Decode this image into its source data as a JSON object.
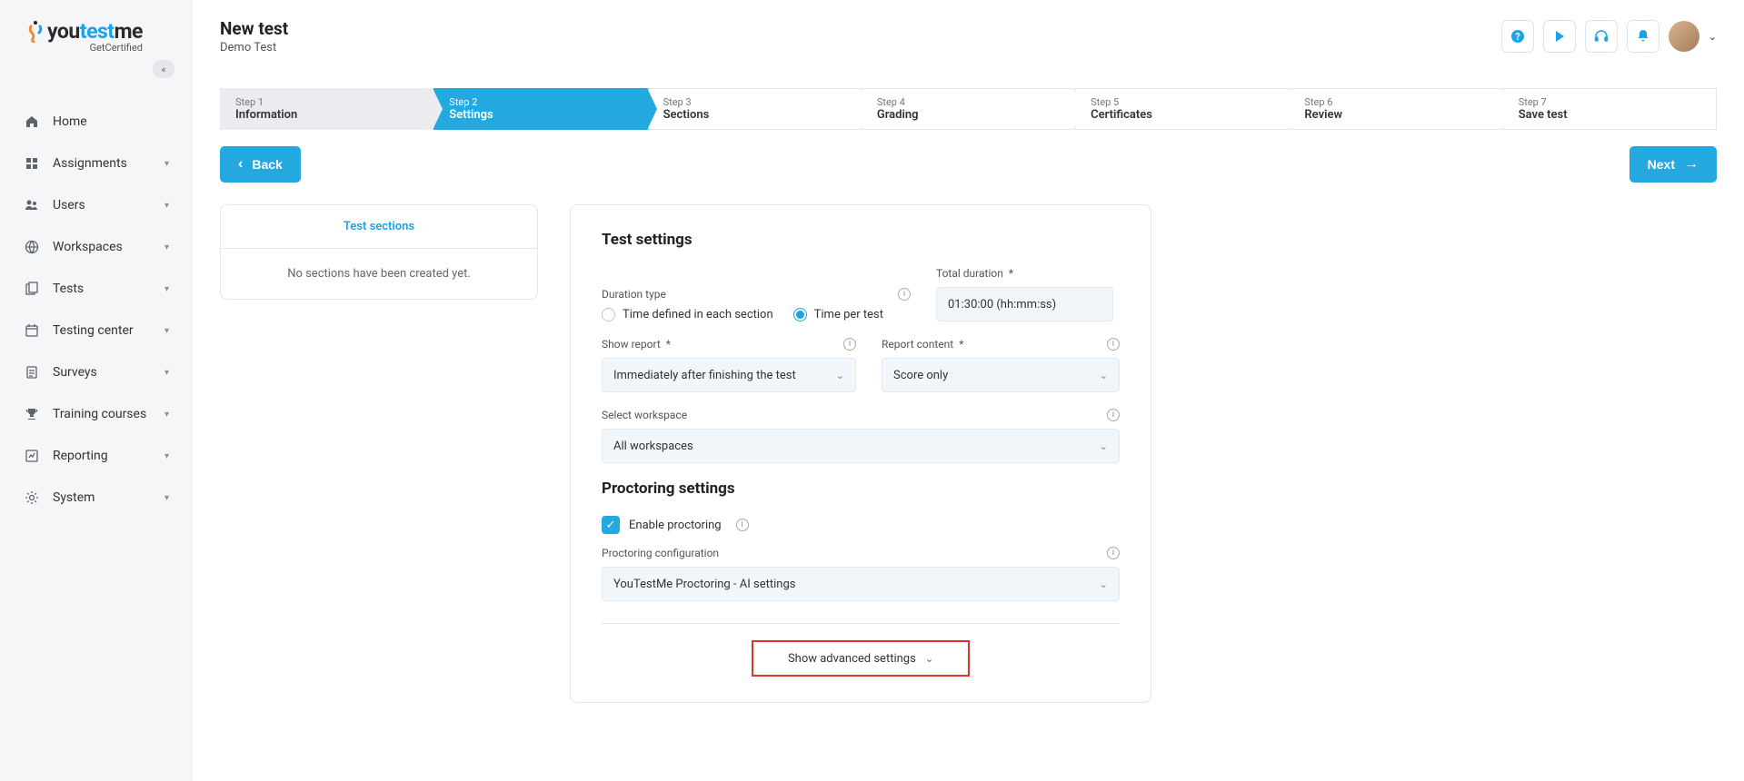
{
  "brand": {
    "you": "you",
    "test": "test",
    "me": "me",
    "sub": "GetCertified"
  },
  "sidebar": {
    "items": [
      {
        "label": "Home",
        "icon": "home",
        "expandable": false
      },
      {
        "label": "Assignments",
        "icon": "assignments",
        "expandable": true
      },
      {
        "label": "Users",
        "icon": "users",
        "expandable": true
      },
      {
        "label": "Workspaces",
        "icon": "globe",
        "expandable": true
      },
      {
        "label": "Tests",
        "icon": "tests",
        "expandable": true
      },
      {
        "label": "Testing center",
        "icon": "calendar",
        "expandable": true
      },
      {
        "label": "Surveys",
        "icon": "surveys",
        "expandable": true
      },
      {
        "label": "Training courses",
        "icon": "trophy",
        "expandable": true
      },
      {
        "label": "Reporting",
        "icon": "reporting",
        "expandable": true
      },
      {
        "label": "System",
        "icon": "gear",
        "expandable": true
      }
    ]
  },
  "page": {
    "title": "New test",
    "subtitle": "Demo Test"
  },
  "stepper": [
    {
      "num": "Step 1",
      "label": "Information",
      "state": "done"
    },
    {
      "num": "Step 2",
      "label": "Settings",
      "state": "active"
    },
    {
      "num": "Step 3",
      "label": "Sections",
      "state": ""
    },
    {
      "num": "Step 4",
      "label": "Grading",
      "state": ""
    },
    {
      "num": "Step 5",
      "label": "Certificates",
      "state": ""
    },
    {
      "num": "Step 6",
      "label": "Review",
      "state": ""
    },
    {
      "num": "Step 7",
      "label": "Save test",
      "state": ""
    }
  ],
  "buttons": {
    "back": "Back",
    "next": "Next"
  },
  "sections_panel": {
    "title": "Test sections",
    "empty": "No sections have been created yet."
  },
  "settings": {
    "heading": "Test settings",
    "duration_type_label": "Duration type",
    "duration_opts": {
      "per_section": "Time defined in each section",
      "per_test": "Time per test"
    },
    "total_duration_label": "Total duration",
    "total_duration_value": "01:30:00 (hh:mm:ss)",
    "show_report_label": "Show report",
    "show_report_value": "Immediately after finishing the test",
    "report_content_label": "Report content",
    "report_content_value": "Score only",
    "workspace_label": "Select workspace",
    "workspace_value": "All workspaces",
    "proctoring_heading": "Proctoring settings",
    "enable_proctoring_label": "Enable proctoring",
    "proctoring_config_label": "Proctoring configuration",
    "proctoring_config_value": "YouTestMe Proctoring - AI settings",
    "advanced_label": "Show advanced settings"
  }
}
